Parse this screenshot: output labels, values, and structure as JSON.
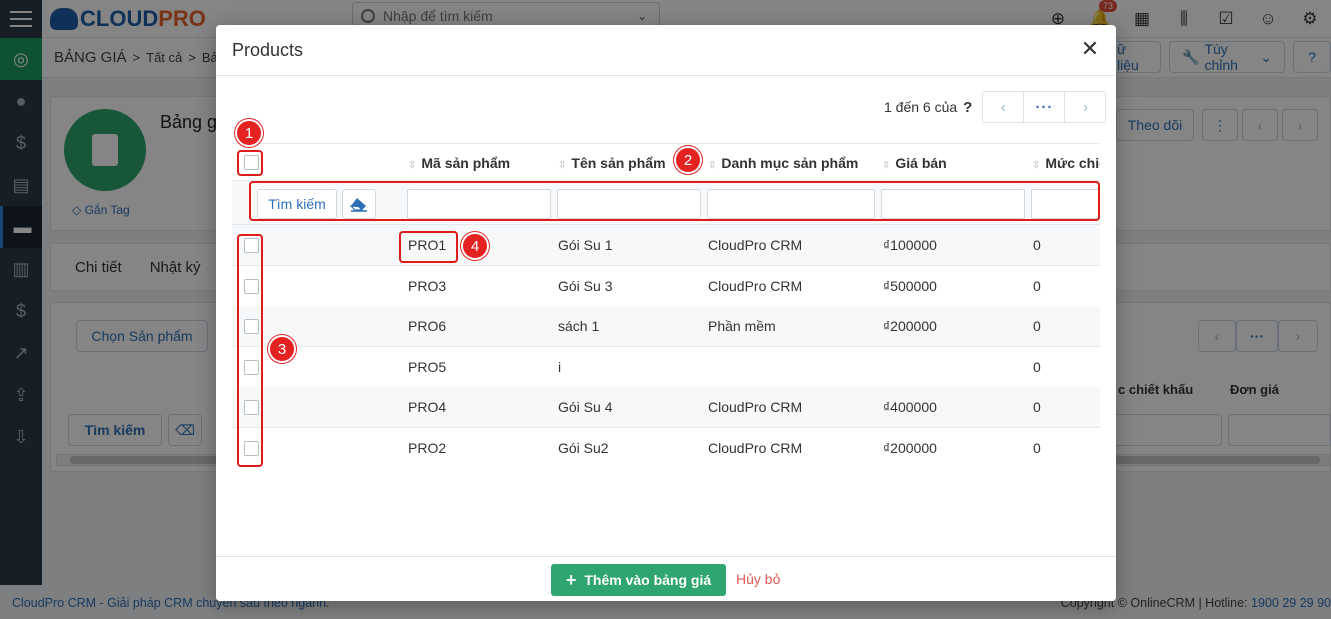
{
  "app": {
    "logo_text_a": "CLOUD",
    "logo_text_b": "PRO",
    "search_placeholder": "Nhập để tìm kiếm",
    "notification_count": "73",
    "breadcrumb": {
      "section": "BẢNG GIÁ",
      "sep": ">",
      "all": "Tất cả",
      "sep2": ">",
      "current": "Bả"
    },
    "header_buttons": {
      "data": "ữ liệu",
      "customize": "Tùy chỉnh",
      "help": "?"
    },
    "record": {
      "title": "Bảng g",
      "tag": "Gắn Tag",
      "follow": "Theo dõi"
    },
    "tabs": [
      "Chi tiết",
      "Nhật ký"
    ],
    "choose_product": "Chọn Sản phẩm",
    "search_button": "Tìm kiếm",
    "bg_columns": {
      "discount": "c chiết khấu",
      "unit_price": "Đơn giá"
    },
    "footer_left": "CloudPro CRM - Giải pháp CRM chuyên sâu theo ngành.",
    "footer_right_text": "Copyright © OnlineCRM | Hotline: ",
    "footer_hotline": "1900 29 29 90"
  },
  "modal": {
    "title": "Products",
    "close_icon": "close-icon",
    "pagination": {
      "text": "1 đến 6 của",
      "total_unknown": "?",
      "more": "···"
    },
    "columns": [
      "Mã sản phẩm",
      "Tên sản phẩm",
      "Danh mục sản phẩm",
      "Giá bán",
      "Mức chiế"
    ],
    "filter": {
      "search_label": "Tìm kiếm",
      "eraser_icon": "eraser-icon"
    },
    "rows": [
      {
        "code": "PRO1",
        "name": "Gói Su 1",
        "category": "CloudPro CRM",
        "price": "₫100000",
        "discount": "0"
      },
      {
        "code": "PRO3",
        "name": "Gói Su 3",
        "category": "CloudPro CRM",
        "price": "₫500000",
        "discount": "0"
      },
      {
        "code": "PRO6",
        "name": "sách 1",
        "category": "Phần mềm",
        "price": "₫200000",
        "discount": "0"
      },
      {
        "code": "PRO5",
        "name": "i",
        "category": "",
        "price": "",
        "discount": "0"
      },
      {
        "code": "PRO4",
        "name": "Gói Su 4",
        "category": "CloudPro CRM",
        "price": "₫400000",
        "discount": "0"
      },
      {
        "code": "PRO2",
        "name": "Gói Su2",
        "category": "CloudPro CRM",
        "price": "₫200000",
        "discount": "0"
      }
    ],
    "add_button": "Thêm vào bảng giá",
    "cancel_button": "Hủy bỏ"
  },
  "annotations": [
    "1",
    "2",
    "3",
    "4"
  ],
  "colors": {
    "accent_green": "#2fa66f",
    "link_blue": "#2c6fb6",
    "annotation_red": "#e01b1b",
    "sidebar": "#2b3a4a"
  }
}
